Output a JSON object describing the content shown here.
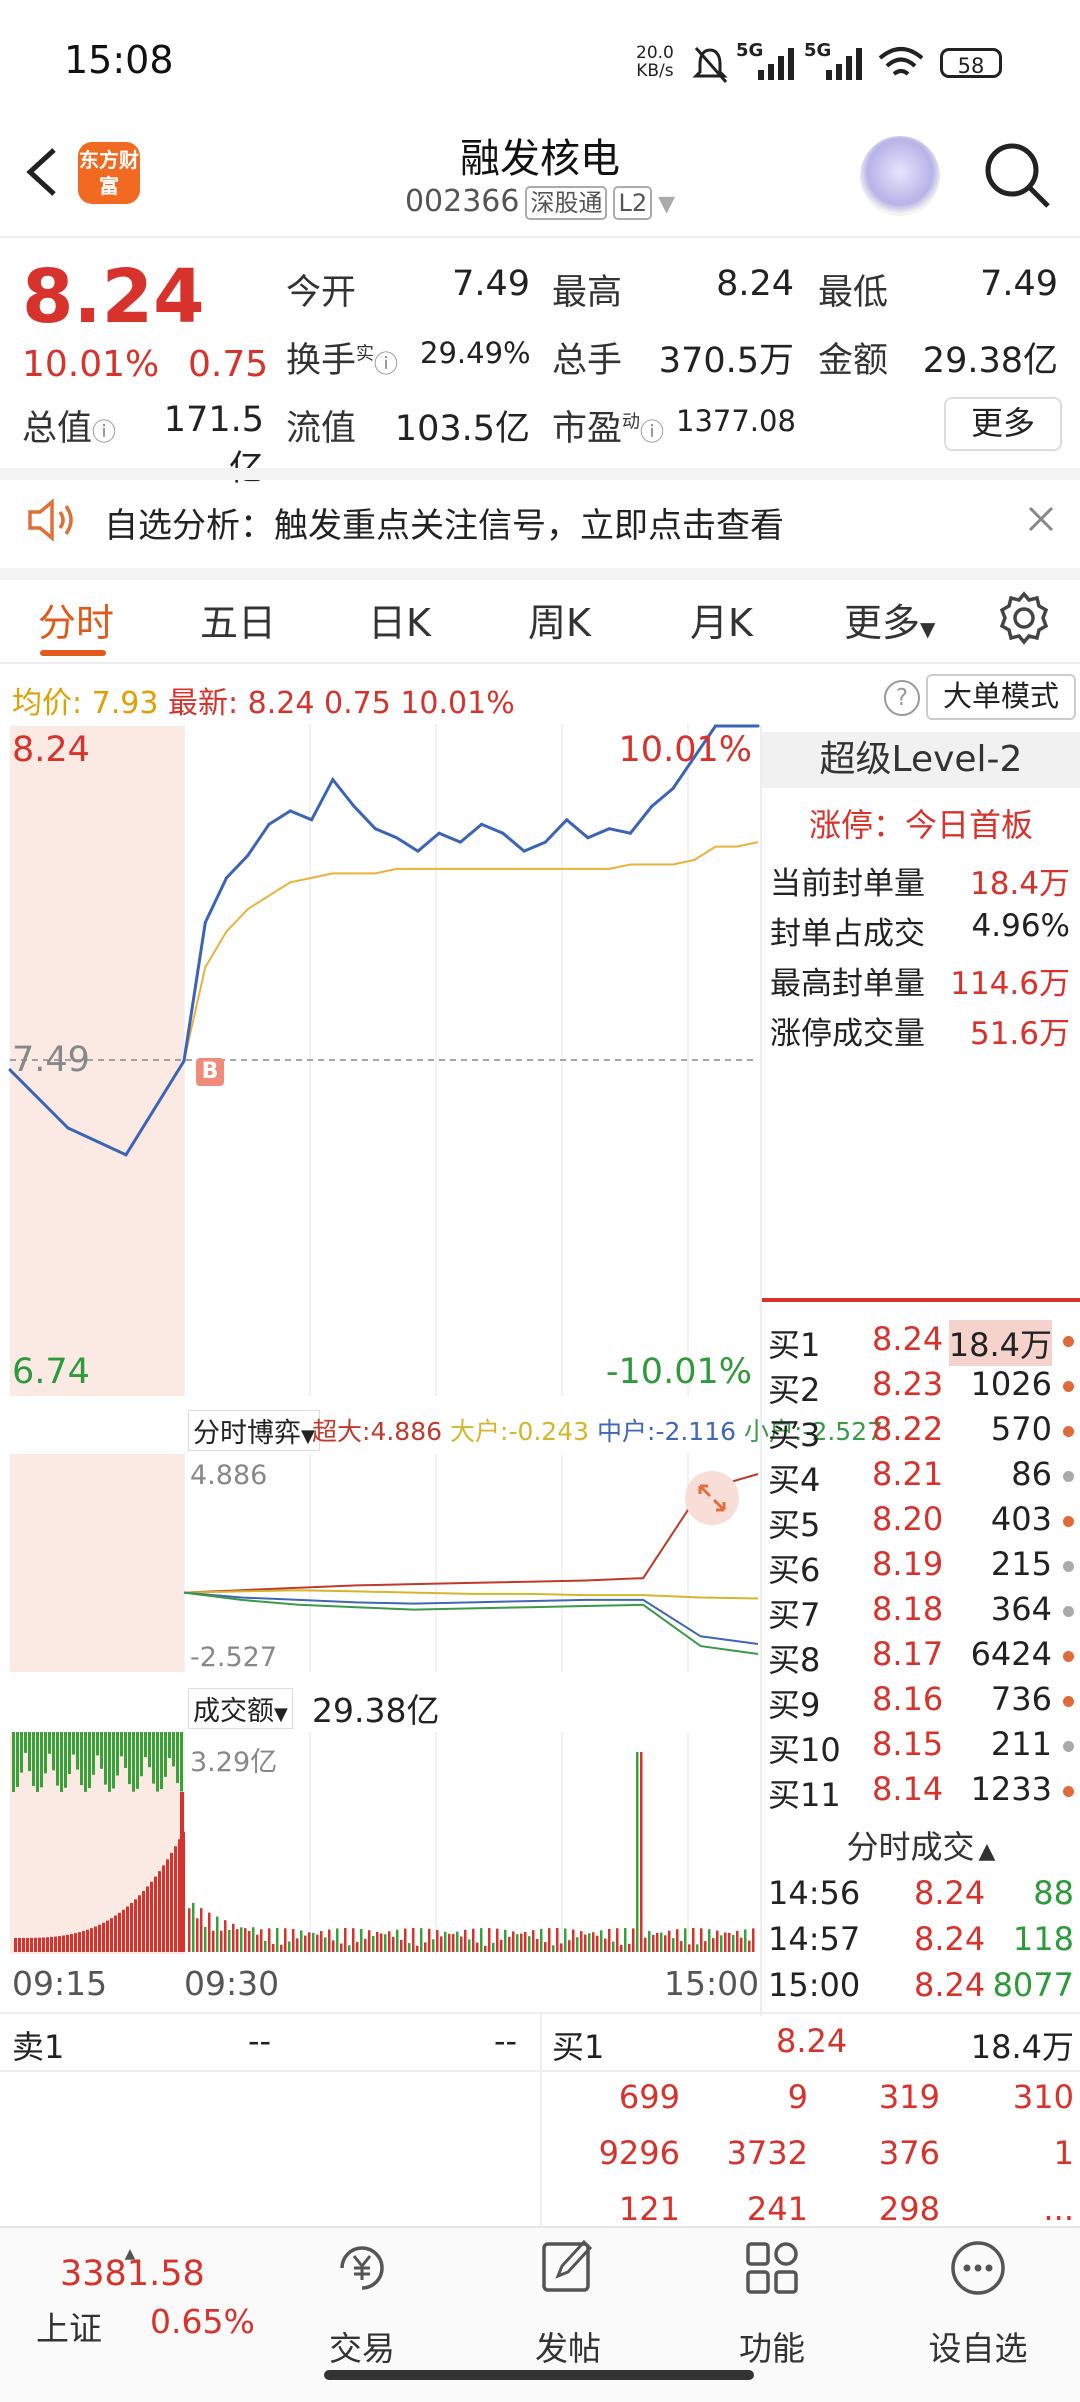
{
  "status_bar": {
    "time": "15:08",
    "net_speed": "20.0",
    "net_unit": "KB/s",
    "signal1": "5G",
    "signal2": "5G",
    "battery": "58"
  },
  "header": {
    "logo_text": "东方财富",
    "title": "融发核电",
    "code": "002366",
    "tag1": "深股通",
    "tag2": "L2"
  },
  "quote": {
    "price": "8.24",
    "change_pct": "10.01%",
    "change": "0.75",
    "stats": [
      {
        "label": "今开",
        "value": "7.49"
      },
      {
        "label": "最高",
        "value": "8.24"
      },
      {
        "label": "最低",
        "value": "7.49"
      },
      {
        "label": "换手",
        "value": "29.49%"
      },
      {
        "label": "总手",
        "value": "370.5万"
      },
      {
        "label": "金额",
        "value": "29.38亿"
      },
      {
        "label": "总值",
        "value": "171.5亿"
      },
      {
        "label": "流值",
        "value": "103.5亿"
      },
      {
        "label": "市盈",
        "value": "1377.08"
      }
    ],
    "turnover_sup": "实",
    "pe_sup": "动",
    "more_label": "更多"
  },
  "banner": {
    "text": "自选分析：触发重点关注信号，立即点击查看"
  },
  "tabs": [
    "分时",
    "五日",
    "日K",
    "周K",
    "月K",
    "更多"
  ],
  "infobar": {
    "avg_label": "均价:",
    "avg_value": "7.93",
    "latest_label": "最新:",
    "latest_value": "8.24",
    "latest_change": "0.75",
    "latest_pct": "10.01%",
    "mode_button": "大单模式"
  },
  "chart_data": [
    {
      "type": "line",
      "x": [
        "09:15",
        "09:20",
        "09:25",
        "09:30",
        "09:35",
        "09:40",
        "09:45",
        "09:50",
        "10:00",
        "10:10",
        "10:20",
        "10:30",
        "10:40",
        "10:50",
        "11:00",
        "11:10",
        "11:20",
        "11:30",
        "13:00",
        "13:10",
        "13:20",
        "13:30",
        "13:40",
        "13:50",
        "14:00",
        "14:10",
        "14:20",
        "14:30",
        "14:40",
        "14:50",
        "15:00"
      ],
      "series": [],
      "y_max_label": "8.24",
      "y_mid_label": "7.49",
      "y_min_label": "6.74",
      "pct_max_label": "10.01%",
      "pct_min_label": "-10.01%",
      "ylim": [
        6.74,
        8.24
      ],
      "price": [
        7.47,
        7.34,
        7.28,
        7.49,
        7.8,
        7.9,
        7.95,
        8.02,
        8.05,
        8.03,
        8.12,
        8.06,
        8.01,
        7.99,
        7.96,
        8.0,
        7.98,
        8.02,
        8.0,
        7.96,
        7.98,
        8.03,
        7.99,
        8.01,
        8.0,
        8.06,
        8.1,
        8.17,
        8.24,
        8.24,
        8.24
      ],
      "avg": [
        null,
        null,
        null,
        7.49,
        7.7,
        7.78,
        7.83,
        7.86,
        7.89,
        7.9,
        7.91,
        7.91,
        7.91,
        7.92,
        7.92,
        7.92,
        7.92,
        7.92,
        7.92,
        7.92,
        7.92,
        7.92,
        7.92,
        7.92,
        7.93,
        7.93,
        7.93,
        7.94,
        7.97,
        7.97,
        7.98
      ]
    },
    {
      "type": "line",
      "indicator_label": "分时博弈",
      "series": [
        {
          "name": "超大",
          "value_label": "4.886",
          "color": "#c0392b",
          "values": [
            0,
            0.1,
            0.2,
            0.3,
            0.35,
            0.4,
            0.45,
            0.5,
            0.6,
            4.2,
            4.886
          ]
        },
        {
          "name": "大户",
          "value_label": "-0.243",
          "color": "#d4b62c",
          "values": [
            0,
            0.05,
            0.1,
            0.05,
            0.0,
            -0.05,
            -0.05,
            -0.1,
            -0.1,
            -0.2,
            -0.243
          ]
        },
        {
          "name": "中户",
          "value_label": "-2.116",
          "color": "#3f67b5",
          "values": [
            0,
            -0.2,
            -0.3,
            -0.4,
            -0.45,
            -0.4,
            -0.35,
            -0.3,
            -0.3,
            -1.8,
            -2.116
          ]
        },
        {
          "name": "小户",
          "value_label": "-2.527",
          "color": "#3a9a4a",
          "values": [
            0,
            -0.3,
            -0.5,
            -0.6,
            -0.7,
            -0.65,
            -0.6,
            -0.55,
            -0.5,
            -2.2,
            -2.527
          ]
        }
      ],
      "y_max_label": "4.886",
      "y_min_label": "-2.527",
      "ylim": [
        -2.527,
        4.886
      ]
    },
    {
      "type": "bar",
      "indicator_label": "成交额",
      "total": "29.38亿",
      "y_max_label": "3.29亿",
      "x_labels": [
        "09:15",
        "09:30",
        "15:00"
      ]
    }
  ],
  "level2": {
    "title": "超级Level-2",
    "limit_status": "涨停：今日首板",
    "rows": [
      {
        "label": "当前封单量",
        "value": "18.4万"
      },
      {
        "label": "封单占成交",
        "value": "4.96%"
      },
      {
        "label": "最高封单量",
        "value": "114.6万"
      },
      {
        "label": "涨停成交量",
        "value": "51.6万"
      }
    ]
  },
  "bids": [
    {
      "label": "买1",
      "price": "8.24",
      "volume": "18.4万"
    },
    {
      "label": "买2",
      "price": "8.23",
      "volume": "1026"
    },
    {
      "label": "买3",
      "price": "8.22",
      "volume": "570"
    },
    {
      "label": "买4",
      "price": "8.21",
      "volume": "86"
    },
    {
      "label": "买5",
      "price": "8.20",
      "volume": "403"
    },
    {
      "label": "买6",
      "price": "8.19",
      "volume": "215"
    },
    {
      "label": "买7",
      "price": "8.18",
      "volume": "364"
    },
    {
      "label": "买8",
      "price": "8.17",
      "volume": "6424"
    },
    {
      "label": "买9",
      "price": "8.16",
      "volume": "736"
    },
    {
      "label": "买10",
      "price": "8.15",
      "volume": "211"
    },
    {
      "label": "买11",
      "price": "8.14",
      "volume": "1233"
    }
  ],
  "trades_header": "分时成交",
  "trades": [
    {
      "time": "14:56",
      "price": "8.24",
      "qty": "88"
    },
    {
      "time": "14:57",
      "price": "8.24",
      "qty": "118"
    },
    {
      "time": "15:00",
      "price": "8.24",
      "qty": "8077"
    }
  ],
  "order_book": {
    "sell_label": "卖1",
    "sell_price": "--",
    "sell_volume": "--",
    "buy_label": "买1",
    "buy_price": "8.24",
    "buy_volume": "18.4万",
    "queue": [
      [
        "699",
        "9",
        "319",
        "310"
      ],
      [
        "9296",
        "3732",
        "376",
        "1"
      ],
      [
        "121",
        "241",
        "298",
        "..."
      ]
    ]
  },
  "bottom_nav": {
    "index_value": "3381.58",
    "index_name": "上证",
    "index_pct": "0.65%",
    "items": [
      "交易",
      "发帖",
      "功能",
      "设自选"
    ]
  }
}
